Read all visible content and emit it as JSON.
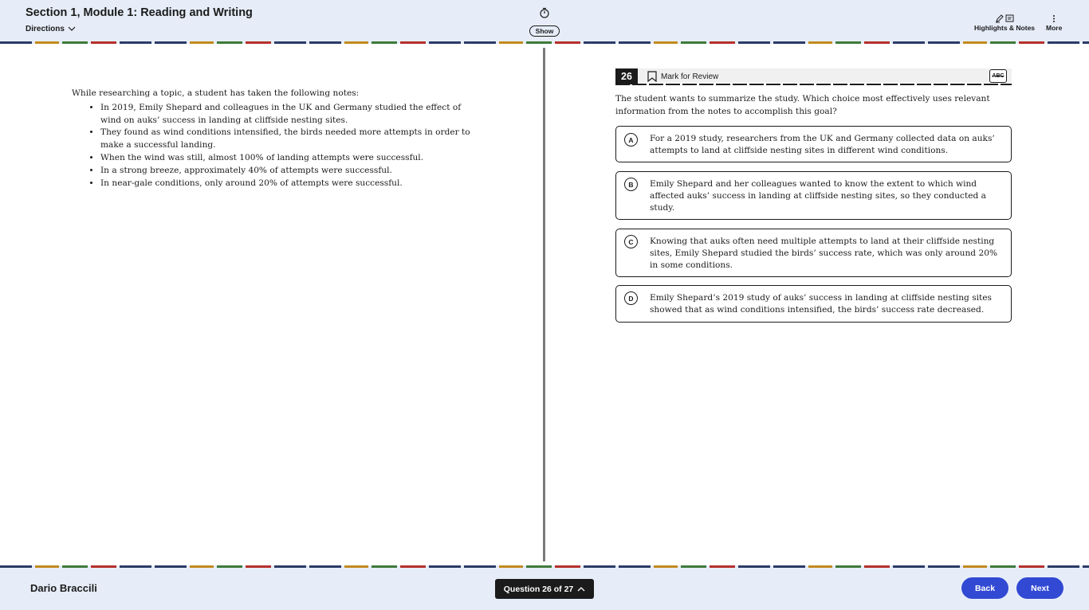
{
  "header": {
    "title": "Section 1, Module 1: Reading and Writing",
    "directions_label": "Directions",
    "timer_toggle_label": "Show",
    "highlights_notes_label": "Highlights & Notes",
    "more_label": "More"
  },
  "passage": {
    "intro": "While researching a topic, a student has taken the following notes:",
    "bullets": [
      "In 2019, Emily Shepard and colleagues in the UK and Germany studied the effect of wind on auks’ success in landing at cliffside nesting sites.",
      "They found as wind conditions intensified, the birds needed more attempts in order to make a successful landing.",
      "When the wind was still, almost 100% of landing attempts were successful.",
      "In a strong breeze, approximately 40% of attempts were successful.",
      "In near-gale conditions, only around 20% of attempts were successful."
    ]
  },
  "question": {
    "number": "26",
    "mark_label": "Mark for Review",
    "abc_label": "ABC",
    "prompt": "The student wants to summarize the study. Which choice most effectively uses relevant information from the notes to accomplish this goal?",
    "choices": [
      {
        "letter": "A",
        "text": "For a 2019 study, researchers from the UK and Germany collected data on auks’ attempts to land at cliffside nesting sites in different wind conditions."
      },
      {
        "letter": "B",
        "text": "Emily Shepard and her colleagues wanted to know the extent to which wind affected auks’ success in landing at cliffside nesting sites, so they conducted a study."
      },
      {
        "letter": "C",
        "text": "Knowing that auks often need multiple attempts to land at their cliffside nesting sites, Emily Shepard studied the birds’ success rate, which was only around 20% in some conditions."
      },
      {
        "letter": "D",
        "text": "Emily Shepard’s 2019 study of auks’ success in landing at cliffside nesting sites showed that as wind conditions intensified, the birds’ success rate decreased."
      }
    ]
  },
  "footer": {
    "student_name": "Dario Braccili",
    "question_nav_label": "Question 26 of 27",
    "back_label": "Back",
    "next_label": "Next"
  },
  "colors": {
    "header_bg": "#e6edf8",
    "accent_blue": "#3249d4",
    "dark": "#1b1b1b"
  }
}
